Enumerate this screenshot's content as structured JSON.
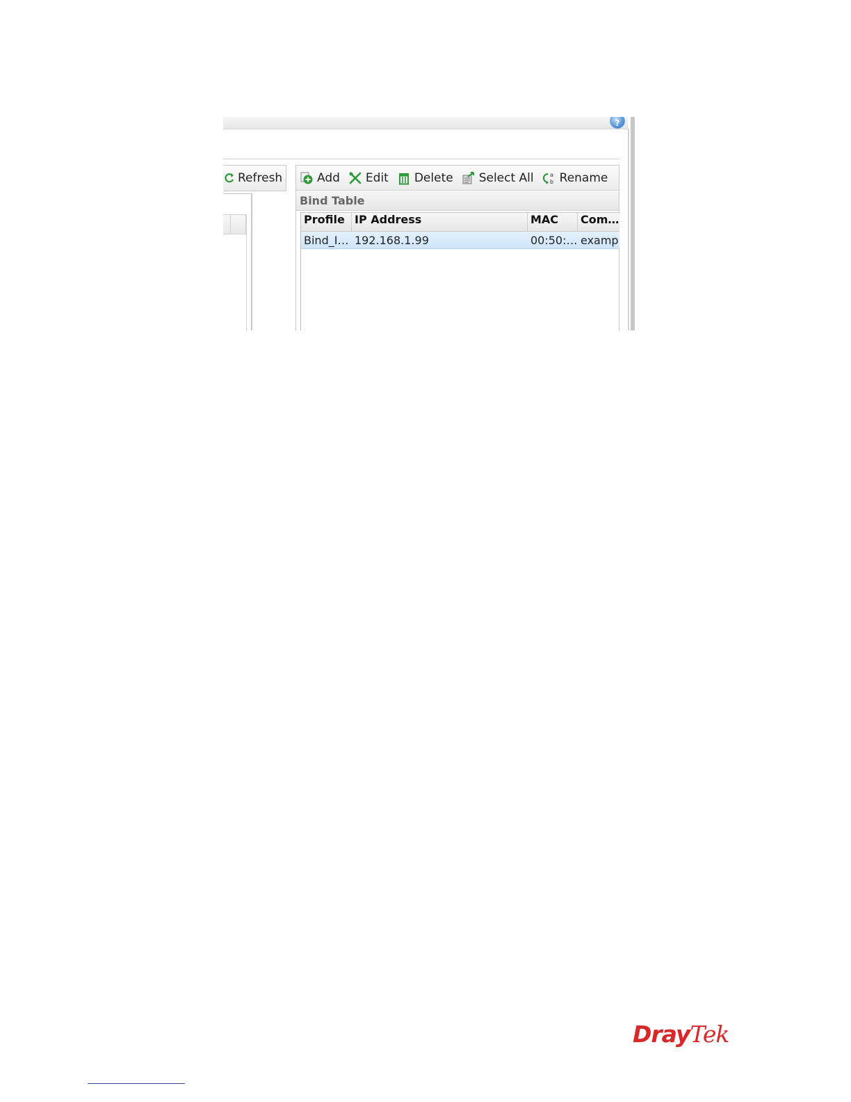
{
  "toolbar_left": {
    "refresh_label": "Refresh"
  },
  "toolbar_right": {
    "add_label": "Add",
    "edit_label": "Edit",
    "delete_label": "Delete",
    "select_all_label": "Select All",
    "rename_label": "Rename"
  },
  "bind_table": {
    "title": "Bind Table",
    "columns": [
      "Profile",
      "IP Address",
      "MAC",
      "Com…"
    ],
    "rows": [
      [
        "Bind_I…",
        "192.168.1.99",
        "00:50:…",
        "exampl"
      ]
    ]
  },
  "help_icon": "help-icon",
  "footer": {
    "logo_part1": "Dray",
    "logo_part2": "Tek"
  },
  "colors": {
    "brand_red": "#d8282a",
    "selected_row": "#d9ebfc",
    "toolbar_icon_green": "#2e9a3a"
  }
}
